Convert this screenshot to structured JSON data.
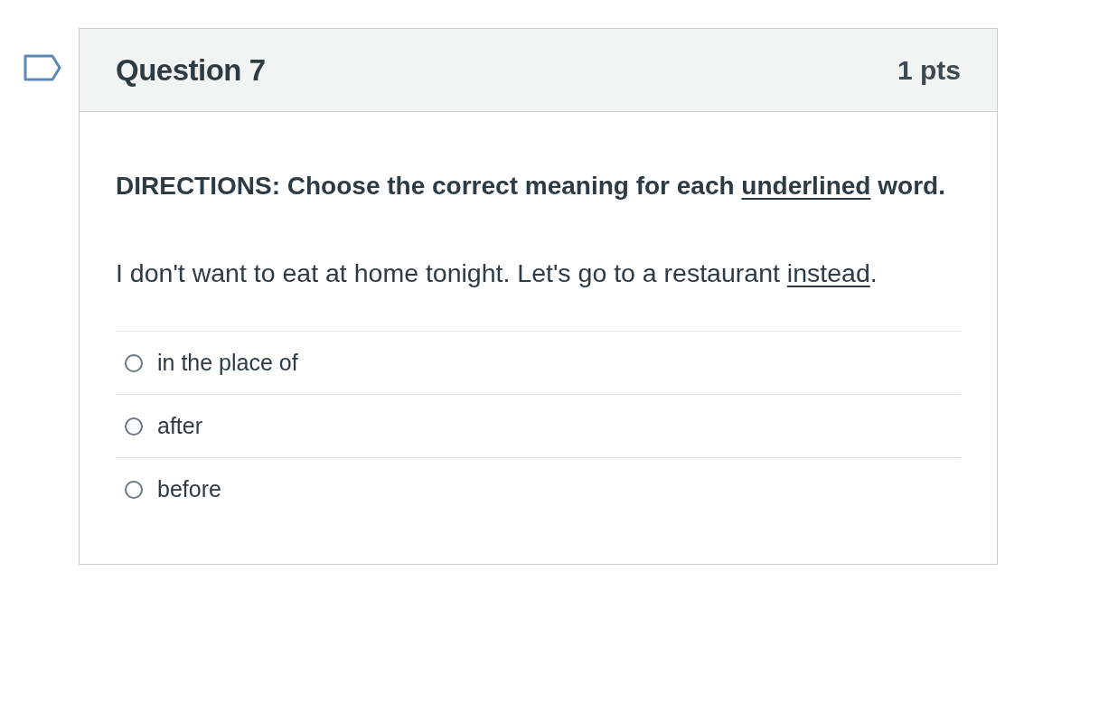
{
  "question": {
    "title": "Question 7",
    "points": "1 pts",
    "flagged": false
  },
  "directions": [
    {
      "text": "DIRECTIONS: Choose the correct meaning for each ",
      "underlined": false
    },
    {
      "text": "underlined",
      "underlined": true
    },
    {
      "text": " word.",
      "underlined": false
    }
  ],
  "sentence": [
    {
      "text": "I don't want to eat at home tonight. Let's go to a restaurant ",
      "underlined": false
    },
    {
      "text": "instead",
      "underlined": true
    },
    {
      "text": ".",
      "underlined": false
    }
  ],
  "answers": [
    {
      "label": "in the place of",
      "selected": false
    },
    {
      "label": "after",
      "selected": false
    },
    {
      "label": "before",
      "selected": false
    }
  ]
}
